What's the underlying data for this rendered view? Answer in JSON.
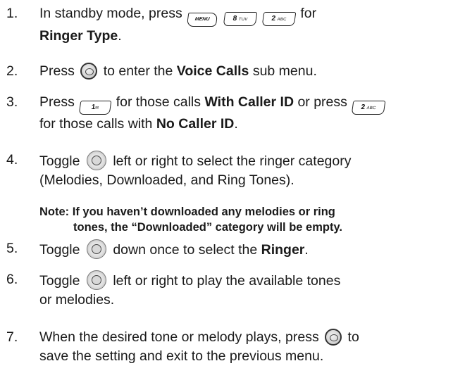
{
  "steps": [
    {
      "num": "1.",
      "line1_pre": "In standby mode, press",
      "line1_post": "for",
      "line2_bold": "Ringer Type",
      "line2_post": "."
    },
    {
      "num": "2.",
      "pre": "Press",
      "mid": "to enter the",
      "bold": "Voice Calls",
      "post": "sub menu."
    },
    {
      "num": "3.",
      "pre": "Press",
      "mid": "for those calls",
      "bold": "With Caller ID",
      "post": "or press",
      "line2_pre": "for those calls with",
      "line2_bold": "No Caller ID",
      "line2_post": "."
    },
    {
      "num": "4.",
      "pre": "Toggle",
      "post": "left or right to select the ringer category",
      "line2": "(Melodies, Downloaded, and Ring Tones)."
    },
    {
      "num": "5.",
      "pre": "Toggle",
      "mid": "down once to select the",
      "bold": "Ringer",
      "post": "."
    },
    {
      "num": "6.",
      "pre": "Toggle",
      "post": "left or right to play the available tones",
      "line2": "or melodies."
    },
    {
      "num": "7.",
      "pre": "When the desired tone or melody plays, press",
      "post": "to",
      "line2": "save the setting and exit to the previous menu."
    }
  ],
  "note": {
    "line1": "Note: If you haven’t downloaded any melodies or ring",
    "line2": "tones, the “Downloaded” category will be empty."
  },
  "keys": {
    "menu": "MENU",
    "k8_digit": "8",
    "k8_letters": "TUV",
    "k2_digit": "2",
    "k2_letters": "ABC",
    "k1_digit": "1",
    "k1_glyph": "✉"
  },
  "icons": [
    "menu-key-icon",
    "key-8-icon",
    "key-2-icon",
    "ok-button-icon",
    "key-1-icon",
    "navigation-key-icon"
  ]
}
